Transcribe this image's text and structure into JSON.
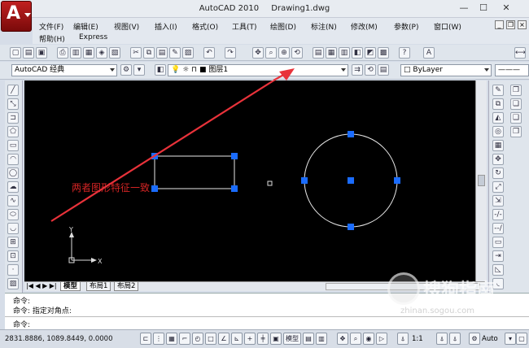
{
  "title": {
    "app": "AutoCAD 2010",
    "file": "Drawing1.dwg"
  },
  "menu": [
    "文件(F)",
    "编辑(E)",
    "视图(V)",
    "插入(I)",
    "格式(O)",
    "工具(T)",
    "绘图(D)",
    "标注(N)",
    "修改(M)",
    "参数(P)",
    "窗口(W)"
  ],
  "menu2": [
    "帮助(H)",
    "Express"
  ],
  "workspace": "AutoCAD 经典",
  "layer": "图层1",
  "color_control": "ByLayer",
  "annotation": "两者图形特征一致",
  "axes": {
    "x": "X",
    "y": "Y"
  },
  "tabs": {
    "model": "模型",
    "layout1": "布局1",
    "layout2": "布局2"
  },
  "command": {
    "line1": "命令:",
    "line2": "命令:  指定对角点:",
    "line3": "命令:"
  },
  "status": {
    "coords": "2831.8886, 1089.8449, 0.0000",
    "model": "模型",
    "scale": "1:1",
    "auto": "Auto"
  },
  "watermark": {
    "text": "搜狗指南",
    "url": "zhinan.sogou.com"
  },
  "colors": {
    "accent_arrow": "#e8323a",
    "grip": "#1a6cff",
    "background": "#000000",
    "annotation": "#d42424"
  }
}
